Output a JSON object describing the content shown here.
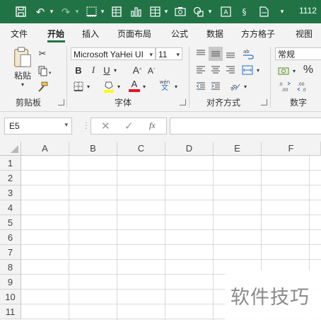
{
  "colors": {
    "title_bar": "#217346",
    "accent_underline": "#217346",
    "ribbon_bg": "#f3f3f3",
    "font_color_bar": "#e81123",
    "highlight_bar": "#ffff00"
  },
  "titlebar": {
    "file_title": "1112"
  },
  "tabs": [
    {
      "label": "文件",
      "active": false
    },
    {
      "label": "开始",
      "active": true
    },
    {
      "label": "插入",
      "active": false
    },
    {
      "label": "页面布局",
      "active": false
    },
    {
      "label": "公式",
      "active": false
    },
    {
      "label": "数据",
      "active": false
    },
    {
      "label": "方方格子",
      "active": false
    },
    {
      "label": "视图",
      "active": false
    }
  ],
  "ribbon": {
    "clipboard": {
      "paste_label": "粘贴",
      "group_label": "剪贴板"
    },
    "font": {
      "font_name": "Microsoft YaHei UI",
      "font_size": "11",
      "bold": "B",
      "italic": "I",
      "underline": "U",
      "grow": "A",
      "shrink": "A",
      "font_color_letter": "A",
      "phonetic": "wén",
      "group_label": "字体"
    },
    "alignment": {
      "group_label": "对齐方式"
    },
    "number": {
      "format": "常规",
      "percent": "%",
      "group_label": "数字"
    }
  },
  "formula_bar": {
    "name_box": "E5",
    "fx": "fx",
    "formula": ""
  },
  "sheet": {
    "columns": [
      "A",
      "B",
      "C",
      "D",
      "E",
      "F"
    ],
    "rows": [
      "1",
      "2",
      "3",
      "4",
      "5",
      "6",
      "7",
      "8",
      "9",
      "10",
      "11"
    ]
  },
  "watermark": "软件技巧"
}
